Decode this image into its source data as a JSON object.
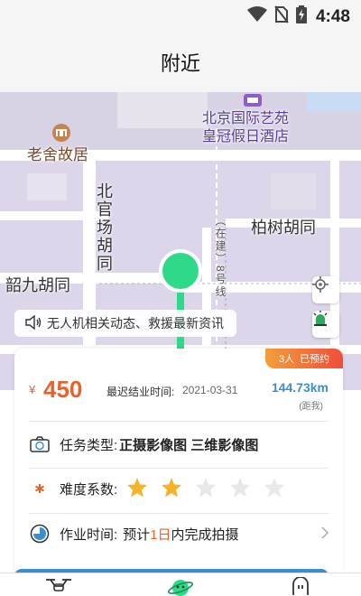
{
  "status": {
    "time": "4:48",
    "icons": [
      "wifi-icon",
      "no-sim-icon",
      "battery-charging-icon"
    ]
  },
  "header": {
    "title": "附近"
  },
  "map": {
    "labels": {
      "laoshe": "老舍故居",
      "hotel_line1": "北京国际艺苑",
      "hotel_line2": "皇冠假日酒店",
      "beiguan": "北官场胡同",
      "baishu": "柏树胡同",
      "shaojiu": "韶九胡同",
      "street": "（在建）8号线"
    },
    "colors": {
      "land": "#ddd6ea",
      "road": "#ffffff",
      "pin": "#2fd98a"
    }
  },
  "notice": {
    "text": "无人机相关动态、救援最新资讯"
  },
  "task": {
    "badge": {
      "count": "3人",
      "status": "已预约"
    },
    "currency": "¥",
    "price": "450",
    "deadline_label": "最迟结业时间:",
    "deadline_value": "2021-03-31",
    "distance": "144.73km",
    "distance_sub": "(距我)",
    "type_label": "任务类型:",
    "type_value": "正摄影像图  三维影像图",
    "difficulty_label": "难度系数:",
    "difficulty_rating": 2,
    "difficulty_max": 5,
    "time_label": "作业时间:",
    "time_prefix": "预计",
    "time_highlight": "1日",
    "time_suffix": "内完成拍摄"
  },
  "theme": {
    "accent": "#3a8fd0",
    "price": "#e8622d",
    "star_on": "#f5b32a",
    "star_off": "#e8e8e8"
  }
}
